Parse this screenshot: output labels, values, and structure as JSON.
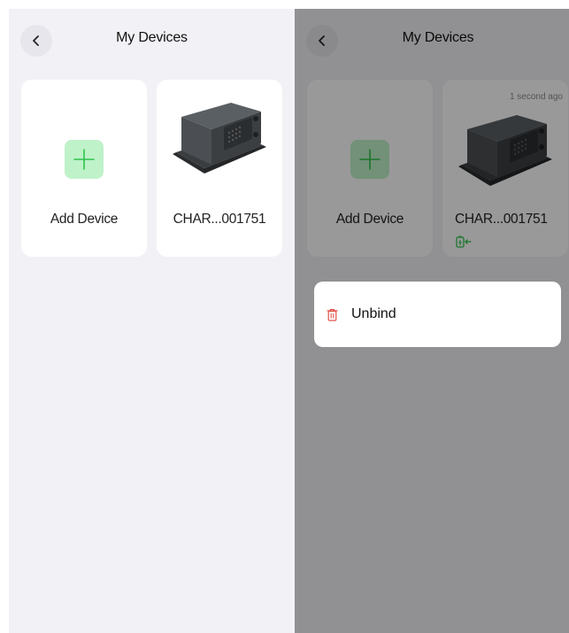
{
  "left_screen": {
    "title": "My Devices",
    "cards": {
      "add_label": "Add Device",
      "device_label": "CHAR...001751"
    }
  },
  "right_screen": {
    "title": "My Devices",
    "cards": {
      "add_label": "Add Device",
      "device_label": "CHAR...001751",
      "device_time": "1 second ago"
    },
    "popup": {
      "unbind_label": "Unbind"
    }
  },
  "colors": {
    "accent_green": "#2fc34a",
    "plus_bg": "#bff2c9",
    "danger": "#e0504a"
  },
  "icons": [
    "back-icon",
    "plus-icon",
    "charging-icon",
    "trash-icon"
  ]
}
